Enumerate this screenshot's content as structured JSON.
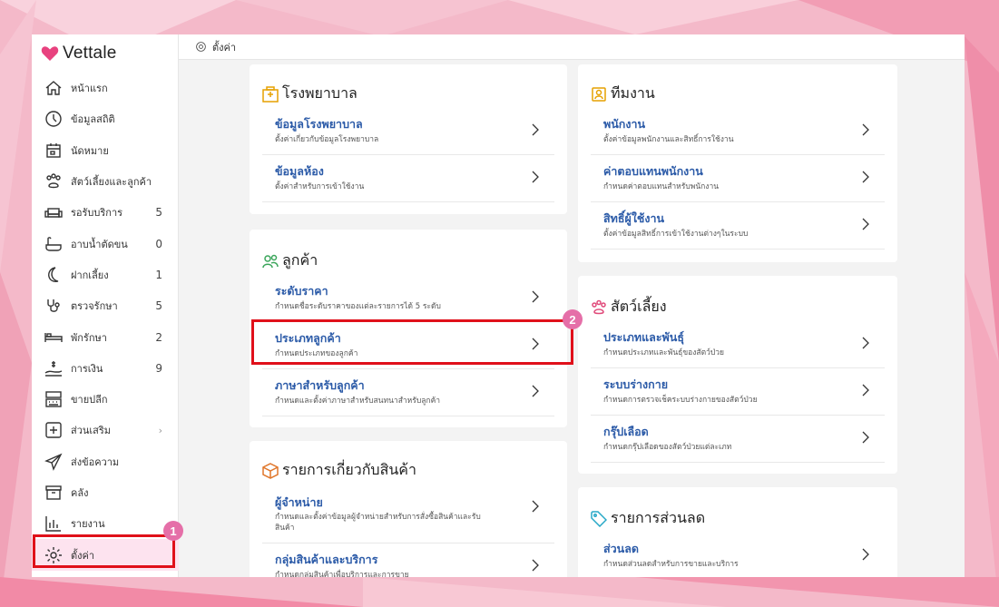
{
  "colors": {
    "brand_pink": "#e56fa8",
    "link_blue": "#2c5ba8",
    "highlight_red": "#e0101a",
    "active_bg": "#fde3ef"
  },
  "brand": {
    "name": "Vettale",
    "icon": "heart-icon"
  },
  "topbar": {
    "icon": "gear-icon",
    "label": "ตั้งค่า"
  },
  "sidebar": {
    "items": [
      {
        "label": "หน้าแรก",
        "icon": "home-icon",
        "count": ""
      },
      {
        "label": "ข้อมูลสถิติ",
        "icon": "gauge-icon",
        "count": ""
      },
      {
        "label": "นัดหมาย",
        "icon": "calendar-icon",
        "count": ""
      },
      {
        "label": "สัตว์เลี้ยงและลูกค้า",
        "icon": "paw-icon",
        "count": ""
      },
      {
        "label": "รอรับบริการ",
        "icon": "couch-icon",
        "count": "5"
      },
      {
        "label": "อาบน้ำตัดขน",
        "icon": "bathtub-icon",
        "count": "0"
      },
      {
        "label": "ฝากเลี้ยง",
        "icon": "moon-icon",
        "count": "1"
      },
      {
        "label": "ตรวจรักษา",
        "icon": "stethoscope-icon",
        "count": "5"
      },
      {
        "label": "พักรักษา",
        "icon": "bed-icon",
        "count": "2"
      },
      {
        "label": "การเงิน",
        "icon": "money-hand-icon",
        "count": "9"
      },
      {
        "label": "ขายปลีก",
        "icon": "cash-register-icon",
        "count": ""
      },
      {
        "label": "ส่วนเสริม",
        "icon": "plus-square-icon",
        "count": ""
      },
      {
        "label": "ส่งข้อความ",
        "icon": "send-icon",
        "count": ""
      },
      {
        "label": "คลัง",
        "icon": "archive-icon",
        "count": ""
      },
      {
        "label": "รายงาน",
        "icon": "bar-chart-icon",
        "count": ""
      },
      {
        "label": "ตั้งค่า",
        "icon": "gear-icon",
        "count": ""
      }
    ],
    "addon_chevron": "›"
  },
  "badges": {
    "one": "1",
    "two": "2"
  },
  "cards": {
    "hospital": {
      "title": "โรงพยาบาล",
      "rows": [
        {
          "title": "ข้อมูลโรงพยาบาล",
          "desc": "ตั้งค่าเกี่ยวกับข้อมูลโรงพยาบาล"
        },
        {
          "title": "ข้อมูลห้อง",
          "desc": "ตั้งค่าสำหรับการเข้าใช้งาน"
        }
      ]
    },
    "customer": {
      "title": "ลูกค้า",
      "rows": [
        {
          "title": "ระดับราคา",
          "desc": "กำหนดชื่อระดับราคาของแต่ละรายการได้ 5 ระดับ"
        },
        {
          "title": "ประเภทลูกค้า",
          "desc": "กำหนดประเภทของลูกค้า"
        },
        {
          "title": "ภาษาสำหรับลูกค้า",
          "desc": "กำหนดและตั้งค่าภาษาสำหรับสนทนาสำหรับลูกค้า"
        }
      ]
    },
    "products": {
      "title": "รายการเกี่ยวกับสินค้า",
      "rows": [
        {
          "title": "ผู้จำหน่าย",
          "desc_line1": "กำหนดและตั้งค่าข้อมูลผู้จำหน่ายสำหรับการสั่งซื้อสินค้าและรับ",
          "desc_line2": "สินค้า"
        },
        {
          "title": "กลุ่มสินค้าและบริการ",
          "desc": "กำหนดกลุ่มสินค้าเพื่อบริการและการขาย"
        }
      ]
    },
    "team": {
      "title": "ทีมงาน",
      "rows": [
        {
          "title": "พนักงาน",
          "desc": "ตั้งค่าข้อมูลพนักงานและสิทธิ์การใช้งาน"
        },
        {
          "title": "ค่าตอบแทนพนักงาน",
          "desc": "กำหนดค่าตอบแทนสำหรับพนักงาน"
        },
        {
          "title": "สิทธิ์ผู้ใช้งาน",
          "desc": "ตั้งค่าข้อมูลสิทธิ์การเข้าใช้งานต่างๆในระบบ"
        }
      ]
    },
    "pets": {
      "title": "สัตว์เลี้ยง",
      "rows": [
        {
          "title": "ประเภทและพันธุ์",
          "desc": "กำหนดประเภทและพันธุ์ของสัตว์ป่วย"
        },
        {
          "title": "ระบบร่างกาย",
          "desc": "กำหนดการตรวจเช็คระบบร่างกายของสัตว์ป่วย"
        },
        {
          "title": "กรุ๊ปเลือด",
          "desc": "กำหนดกรุ๊ปเลือดของสัตว์ป่วยแต่ละเภท"
        }
      ]
    },
    "discount": {
      "title": "รายการส่วนลด",
      "rows": [
        {
          "title": "ส่วนลด",
          "desc": "กำหนดส่วนลดสำหรับการขายและบริการ"
        }
      ]
    }
  }
}
